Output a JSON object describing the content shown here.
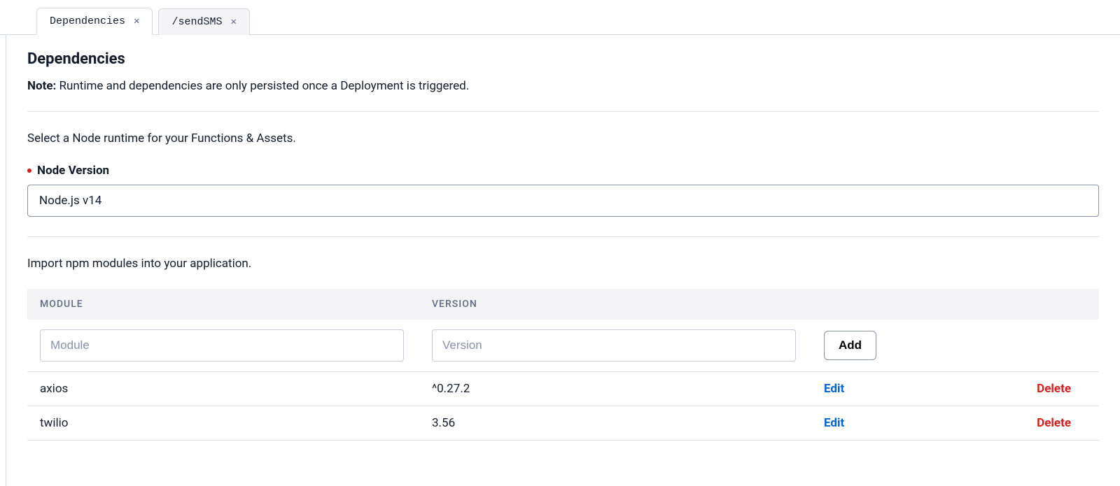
{
  "tabs": [
    {
      "label": "Dependencies",
      "active": true
    },
    {
      "label": "/sendSMS",
      "active": false
    }
  ],
  "header": {
    "title": "Dependencies",
    "note_bold": "Note:",
    "note_text": " Runtime and dependencies are only persisted once a Deployment is triggered."
  },
  "runtime": {
    "lead": "Select a Node runtime for your Functions & Assets.",
    "label": "Node Version",
    "value": "Node.js v14"
  },
  "modules": {
    "lead": "Import npm modules into your application.",
    "columns": {
      "module": "MODULE",
      "version": "VERSION"
    },
    "input": {
      "module_placeholder": "Module",
      "version_placeholder": "Version",
      "add_label": "Add"
    },
    "rows": [
      {
        "module": "axios",
        "version": "^0.27.2",
        "edit": "Edit",
        "delete": "Delete"
      },
      {
        "module": "twilio",
        "version": "3.56",
        "edit": "Edit",
        "delete": "Delete"
      }
    ]
  }
}
